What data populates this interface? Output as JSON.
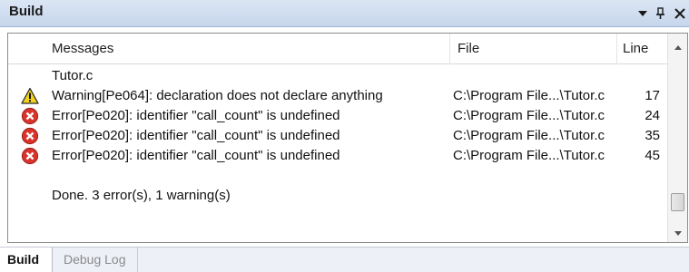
{
  "window": {
    "title": "Build",
    "dropdown_icon": "chevron-down-icon",
    "pin_icon": "pin-icon",
    "close_icon": "close-icon"
  },
  "messages_panel": {
    "columns": {
      "messages": "Messages",
      "file": "File",
      "line": "Line"
    },
    "rows": [
      {
        "icon": "none",
        "message": "Tutor.c",
        "file": "",
        "line": ""
      },
      {
        "icon": "warning-icon",
        "message": "Warning[Pe064]: declaration does not declare anything",
        "file": "C:\\Program File...\\Tutor.c",
        "line": "17"
      },
      {
        "icon": "error-icon",
        "message": "Error[Pe020]: identifier \"call_count\" is undefined",
        "file": "C:\\Program File...\\Tutor.c",
        "line": "24"
      },
      {
        "icon": "error-icon",
        "message": "Error[Pe020]: identifier \"call_count\" is undefined",
        "file": "C:\\Program File...\\Tutor.c",
        "line": "35"
      },
      {
        "icon": "error-icon",
        "message": "Error[Pe020]: identifier \"call_count\" is undefined",
        "file": "C:\\Program File...\\Tutor.c",
        "line": "45"
      },
      {
        "icon": "none",
        "message": "",
        "file": "",
        "line": ""
      },
      {
        "icon": "none",
        "message": "Done. 3 error(s), 1 warning(s)",
        "file": "",
        "line": ""
      }
    ]
  },
  "tabs": [
    {
      "label": "Build",
      "active": true
    },
    {
      "label": "Debug Log",
      "active": false
    }
  ],
  "colors": {
    "titlebar": "#c7d6ec",
    "warning": "#f2d21b",
    "error": "#d9342b",
    "tab_inactive_text": "#8a8a8a"
  }
}
